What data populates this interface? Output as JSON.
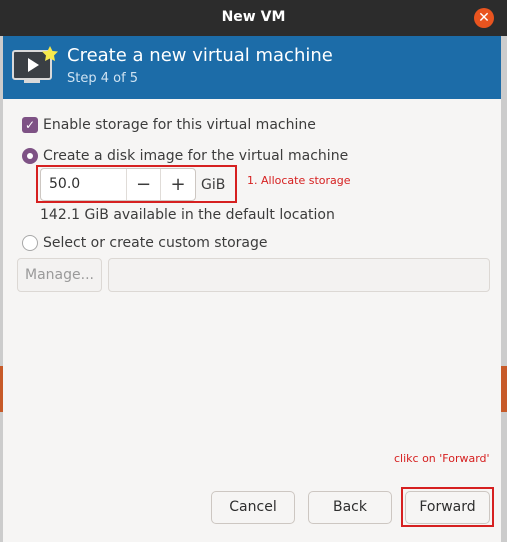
{
  "window": {
    "title": "New VM"
  },
  "header": {
    "title": "Create a new virtual machine",
    "step": "Step 4 of 5"
  },
  "storage": {
    "enable_label": "Enable storage for this virtual machine",
    "enable_checked": true,
    "create_disk_label": "Create a disk image for the virtual machine",
    "disk_size": "50.0",
    "unit": "GiB",
    "available": "142.1 GiB available in the default location",
    "custom_label": "Select or create custom storage",
    "manage_label": "Manage...",
    "path_value": ""
  },
  "annotations": {
    "step1": "1. Allocate storage",
    "step2": "clikc on 'Forward'"
  },
  "buttons": {
    "cancel": "Cancel",
    "back": "Back",
    "forward": "Forward"
  },
  "colors": {
    "header_bg": "#1c6ca8",
    "accent": "#7e5285",
    "highlight": "#d62020",
    "close": "#e9541f"
  }
}
